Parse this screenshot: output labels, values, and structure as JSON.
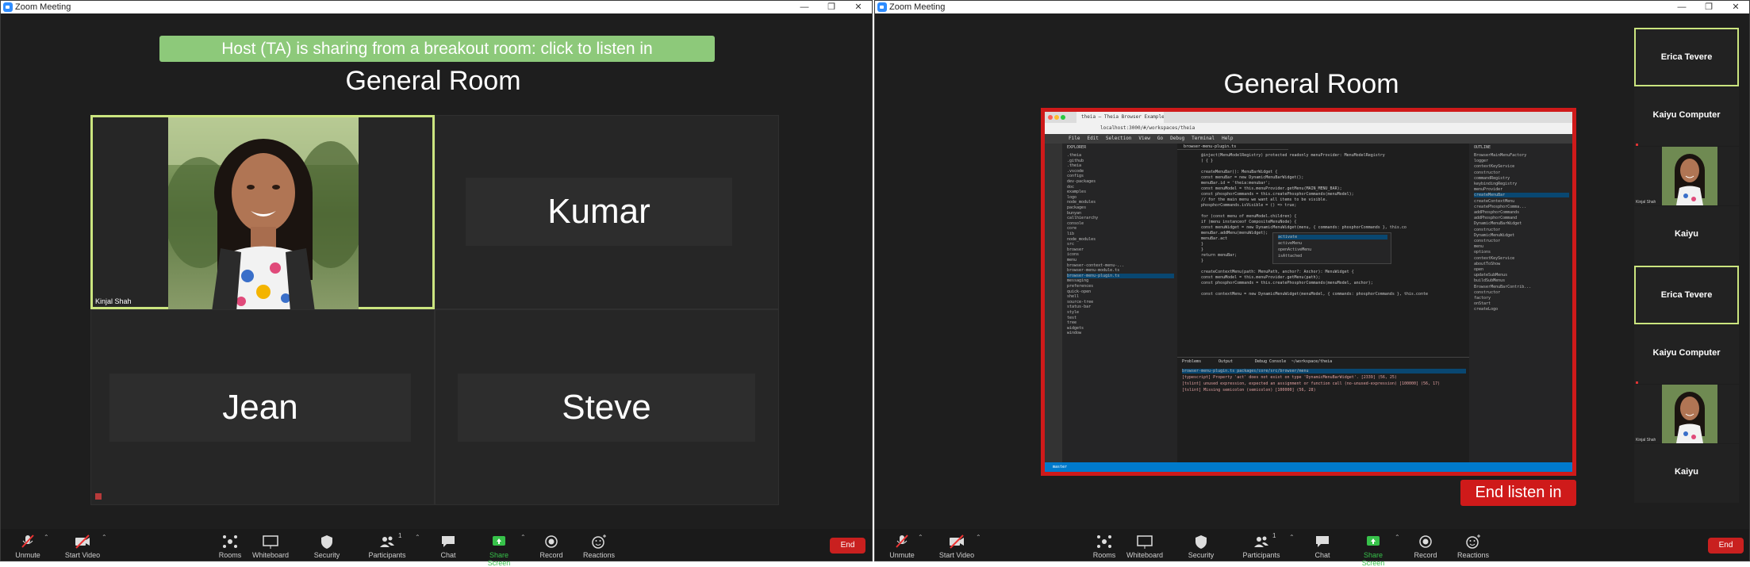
{
  "left": {
    "window_title": "Zoom Meeting",
    "banner": "Host (TA) is sharing from a breakout room: click to listen in",
    "room_title": "General Room",
    "tiles": [
      {
        "name": "Kinjal Shah"
      },
      {
        "name": "Kumar"
      },
      {
        "name": "Jean"
      },
      {
        "name": "Steve"
      }
    ],
    "toolbar": {
      "unmute": "Unmute",
      "start_video": "Start Video",
      "rooms": "Rooms",
      "whiteboard": "Whiteboard",
      "security": "Security",
      "participants": "Participants",
      "participants_count": "1",
      "chat": "Chat",
      "share_screen": "Share Screen",
      "record": "Record",
      "reactions": "Reactions",
      "end": "End"
    }
  },
  "right": {
    "window_title": "Zoom Meeting",
    "room_title": "General Room",
    "end_listen": "End listen in",
    "side_tiles": [
      {
        "name": "Erica Tevere",
        "active": true
      },
      {
        "name": "Kaiyu Computer",
        "active": false
      },
      {
        "name": "",
        "video": true,
        "tiny": "Kinjal Shah"
      },
      {
        "name": "Kaiyu",
        "active": false
      },
      {
        "name": "Erica Tevere",
        "active": true
      },
      {
        "name": "Kaiyu Computer",
        "active": false
      },
      {
        "name": "",
        "video": true,
        "tiny": "Kinjal Shah"
      },
      {
        "name": "Kaiyu",
        "active": false
      }
    ],
    "toolbar": {
      "unmute": "Unmute",
      "start_video": "Start Video",
      "rooms": "Rooms",
      "whiteboard": "Whiteboard",
      "security": "Security",
      "participants": "Participants",
      "participants_count": "1",
      "chat": "Chat",
      "share_screen": "Share Screen",
      "record": "Record",
      "reactions": "Reactions",
      "end": "End"
    },
    "shared_screen": {
      "tab_title": "theia — Theia Browser Example",
      "url": "localhost:3000/#/workspaces/theia",
      "menu": [
        "File",
        "Edit",
        "Selection",
        "View",
        "Go",
        "Debug",
        "Terminal",
        "Help"
      ],
      "explorer_title": "EXPLORER",
      "outline_title": "OUTLINE",
      "editor_tab": "browser-menu-plugin.ts",
      "explorer_items": [
        ".theia",
        ".github",
        ".theia",
        ".vscode",
        "configs",
        "dev-packages",
        "doc",
        "examples",
        "logo",
        "node_modules",
        "packages",
        "bunyan",
        "callhierarchy",
        "console",
        "core",
        "lib",
        "node_modules",
        "src",
        "browser",
        "icons",
        "menu",
        "browser-context-menu-...",
        "browser-menu-module.ts",
        "browser-menu-plugin.ts",
        "messaging",
        "preferences",
        "quick-open",
        "shell",
        "source-tree",
        "status-bar",
        "style",
        "test",
        "tree",
        "widgets",
        "window"
      ],
      "code_lines": [
        "@inject(MenuModelRegistry) protected readonly menuProvider: MenuModelRegistry",
        ") { }",
        "",
        "createMenuBar(): MenuBarWidget {",
        "    const menuBar = new DynamicMenuBarWidget();",
        "    menuBar.id = 'theia:menubar';",
        "    const menuModel = this.menuProvider.getMenu(MAIN_MENU_BAR);",
        "    const phosphorCommands = this.createPhosphorCommands(menuModel);",
        "    // for the main menu we want all items to be visible.",
        "    phosphorCommands.isVisible = () => true;",
        "",
        "    for (const menu of menuModel.children) {",
        "        if (menu instanceof CompositeMenuNode) {",
        "            const menuWidget = new DynamicMenuWidget(menu, { commands: phosphorCommands }, this.co",
        "            menuBar.addMenu(menuWidget);",
        "            menuBar.act",
        "        }",
        "    }",
        "    return menuBar;",
        "}",
        "",
        "createContextMenu(path: MenuPath, anchor?: Anchor): MenuWidget {",
        "    const menuModel = this.menuProvider.getMenu(path);",
        "    const phosphorCommands = this.createPhosphorCommands(menuModel, anchor);",
        "",
        "    const contextMenu = new DynamicMenuWidget(menuModel, { commands: phosphorCommands }, this.conte"
      ],
      "autocomplete": [
        "activate",
        "activeMenu",
        "openActiveMenu",
        "isAttached"
      ],
      "problems_tabs": [
        "Problems",
        "Output",
        "Debug Console",
        "~/workspace/theia"
      ],
      "problems": [
        "browser-menu-plugin.ts  packages/core/src/browser/menu",
        "[typescript] Property 'act' does not exist on type 'DynamicMenuBarWidget'. [2339] (56, 25)",
        "[tslint] unused expression, expected an assignment or function call (no-unused-expression) [100000] (56, 17)",
        "[tslint] Missing semicolon (semicolon) [100000] (56, 28)"
      ],
      "outline_items": [
        "BrowserMainMenuFactory",
        "logger",
        "contextKeyService",
        "constructor",
        "commandRegistry",
        "keybindingRegistry",
        "menuProvider",
        "createMenuBar",
        "createContextMenu",
        "createPhosphorComma...",
        "addPhosphorCommands",
        "addPhosphorCommand",
        "DynamicMenuBarWidget",
        "constructor",
        "DynamicMenuWidget",
        "constructor",
        "menu",
        "options",
        "contextKeyService",
        "aboutToShow",
        "open",
        "updateSubMenus",
        "buildSubMenus",
        "BrowserMenuBarContrib...",
        "constructor",
        "factory",
        "onStart",
        "createLogo"
      ],
      "status": "master"
    }
  }
}
